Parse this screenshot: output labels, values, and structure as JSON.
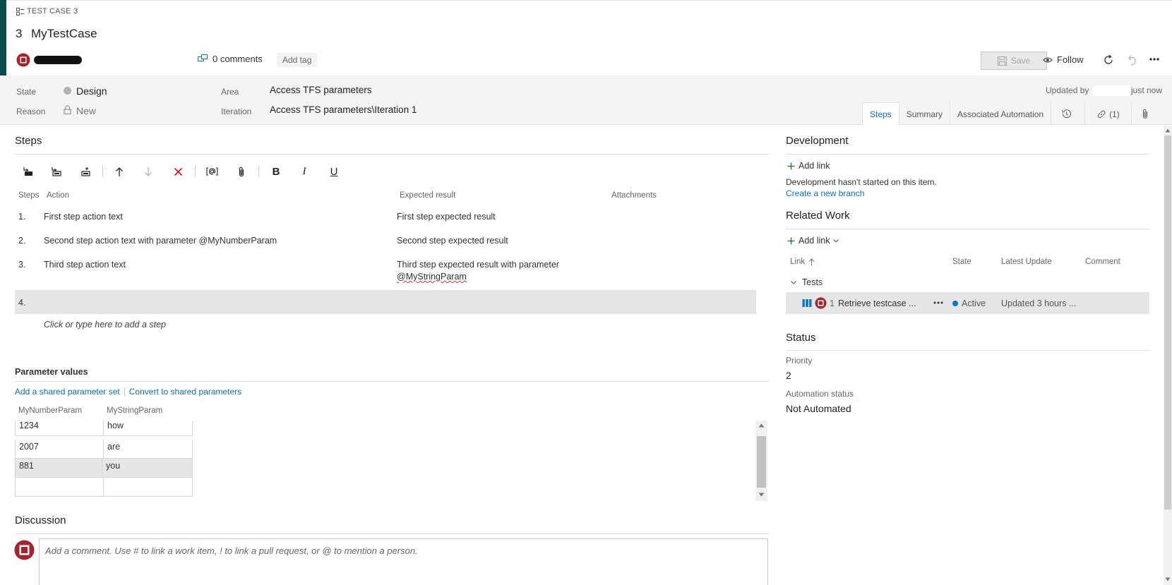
{
  "header": {
    "type_label": "TEST CASE 3",
    "id": "3",
    "title": "MyTestCase",
    "comments": "0 comments",
    "add_tag": "Add tag",
    "save": "Save",
    "follow": "Follow",
    "accent_color": "#0a4b4b"
  },
  "fields": {
    "state_label": "State",
    "state_value": "Design",
    "reason_label": "Reason",
    "reason_value": "New",
    "area_label": "Area",
    "area_value": "Access TFS parameters",
    "iteration_label": "Iteration",
    "iteration_value": "Access TFS parameters\\Iteration 1",
    "updated_by_label": "Updated by",
    "updated_time": "just now"
  },
  "tabs": {
    "steps": "Steps",
    "summary": "Summary",
    "automation": "Associated Automation",
    "links": "(1)",
    "history_icon": "history-icon",
    "attachment_icon": "paperclip-icon"
  },
  "steps": {
    "title": "Steps",
    "toolbar": {
      "bold": "B",
      "italic": "I",
      "underline": "U"
    },
    "columns": {
      "steps": "Steps",
      "action": "Action",
      "expected": "Expected result",
      "attachments": "Attachments"
    },
    "rows": [
      {
        "num": "1.",
        "action": "First step action text",
        "expected": "First step expected result",
        "expected_line2": ""
      },
      {
        "num": "2.",
        "action": "Second step action text with parameter  @MyNumberParam",
        "expected": "Second step expected result",
        "expected_line2": ""
      },
      {
        "num": "3.",
        "action": "Third step action text",
        "expected": "Third step expected result with parameter",
        "expected_line2": "@MyStringParam"
      }
    ],
    "new_row_num": "4.",
    "add_hint": "Click or type here to add a step"
  },
  "parameters": {
    "title": "Parameter values",
    "add_shared": "Add a shared parameter set",
    "convert": "Convert to shared parameters",
    "headers": [
      "MyNumberParam",
      "MyStringParam"
    ],
    "rows": [
      [
        "1234",
        "how"
      ],
      [
        "2007",
        "are"
      ],
      [
        "881",
        "you"
      ],
      [
        "",
        ""
      ]
    ]
  },
  "discussion": {
    "title": "Discussion",
    "placeholder": "Add a comment. Use # to link a work item, ! to link a pull request, or @ to mention a person."
  },
  "development": {
    "title": "Development",
    "add_link": "Add link",
    "message": "Development hasn't started on this item.",
    "create_branch": "Create a new branch"
  },
  "related_work": {
    "title": "Related Work",
    "add_link": "Add link",
    "columns": {
      "link": "Link",
      "state": "State",
      "latest_update": "Latest Update",
      "comment": "Comment"
    },
    "group": "Tests",
    "item": {
      "id": "1",
      "title": "Retrieve testcase ...",
      "state": "Active",
      "updated": "Updated 3 hours ...",
      "state_color": "#007acc"
    }
  },
  "status": {
    "title": "Status",
    "priority_label": "Priority",
    "priority_value": "2",
    "automation_label": "Automation status",
    "automation_value": "Not Automated"
  }
}
